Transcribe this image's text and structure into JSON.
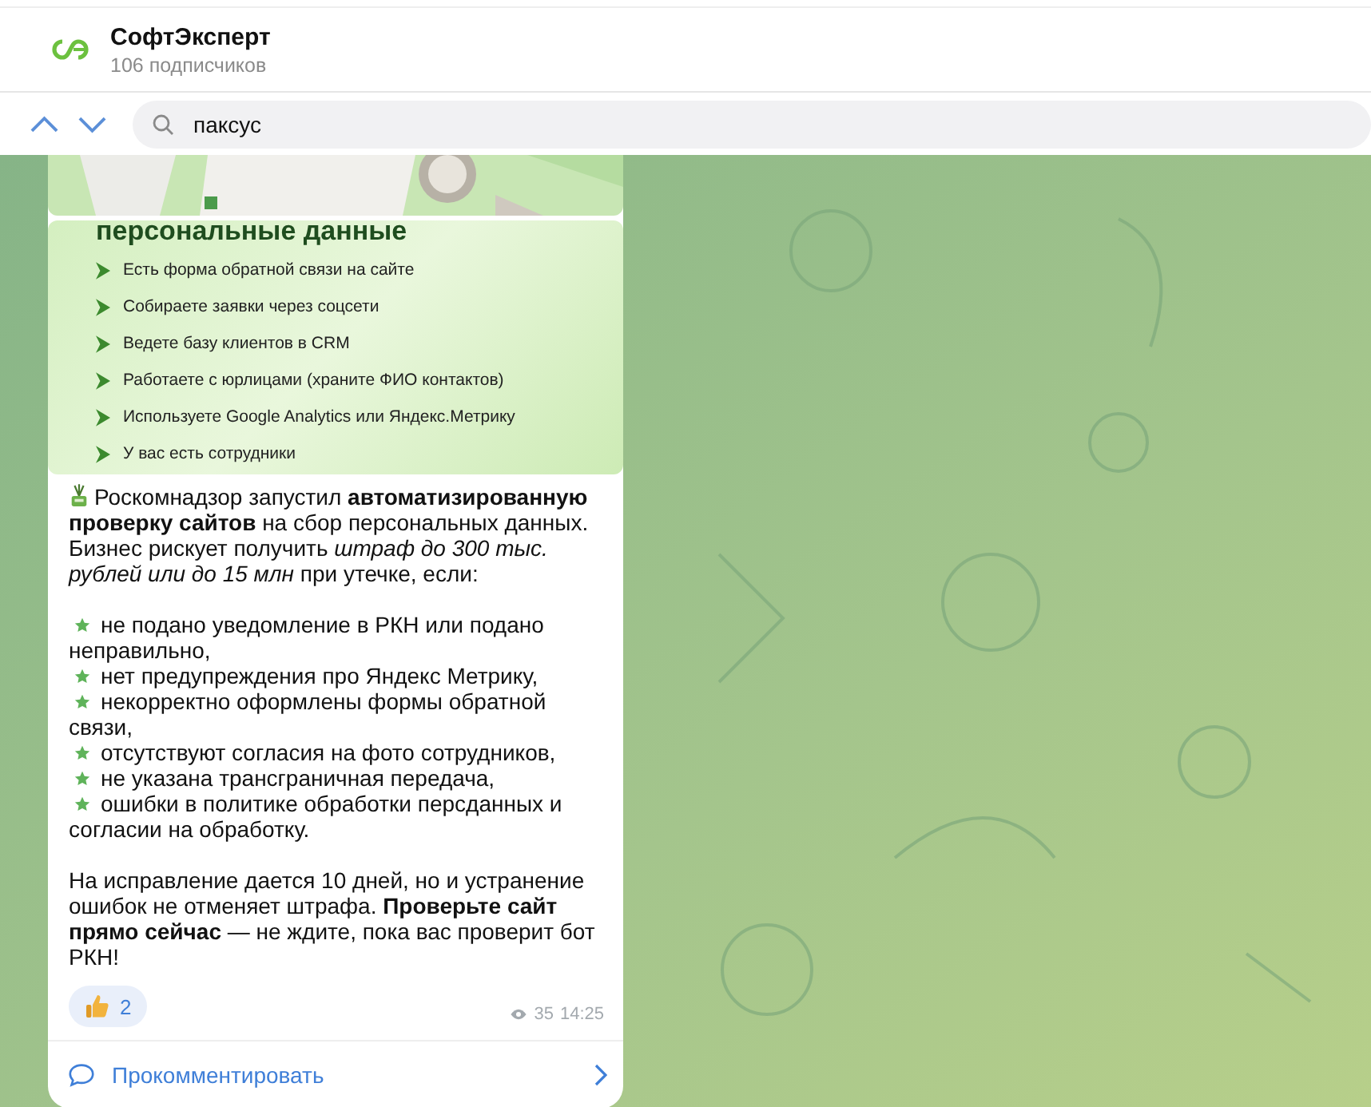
{
  "channel": {
    "title": "СофтЭксперт",
    "subscribers": "106 подписчиков"
  },
  "search": {
    "value": "паксус"
  },
  "message": {
    "image": {
      "heading": "персональные данные",
      "items": [
        "Есть форма обратной связи на сайте",
        "Собираете заявки через соцсети",
        "Ведете базу клиентов в CRM",
        "Работаете с юрлицами (храните ФИО контактов)",
        "Используете Google Analytics или Яндекс.Метрику",
        "У вас есть сотрудники"
      ]
    },
    "intro": "Роскомнадзор запустил **автоматизированную проверку сайтов** на сбор персональных данных. Бизнес рискует получить *штраф до 300 тыс. рублей или до 15 млн* при утечке, если:",
    "bullets": [
      "не подано уведомление в РКН или подано неправильно,",
      "нет предупреждения про Яндекс Метрику,",
      "некорректно оформлены формы обратной связи,",
      "отсутствуют согласия на фото сотрудников,",
      "не указана трансграничная передача,",
      "ошибки в политике обработки персданных и согласии на обработку."
    ],
    "outro": "На исправление дается 10 дней, но и устранение ошибок не отменяет штрафа. **Проверьте сайт прямо сейчас** — не ждите, пока вас проверит бот РКН!",
    "reaction": {
      "count": "2"
    },
    "views": "35",
    "time": "14:25",
    "comment": "Прокомментировать"
  }
}
